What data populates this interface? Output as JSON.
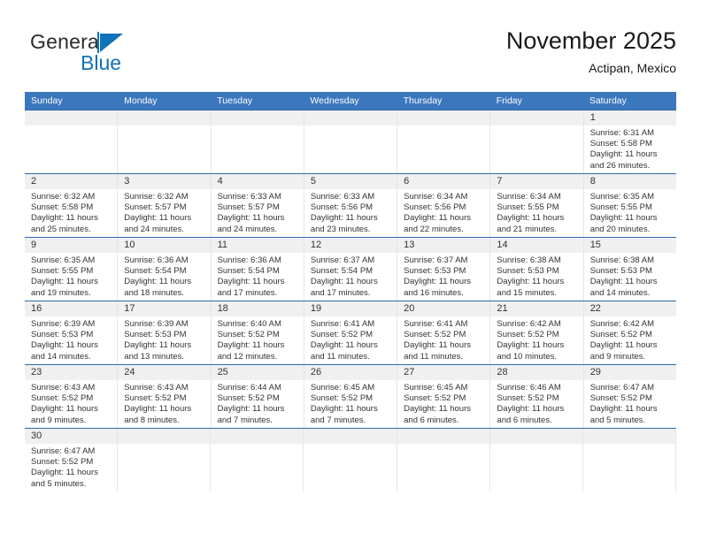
{
  "brand": {
    "name_part1": "General",
    "name_part2": "Blue",
    "accent_color": "#1272b8",
    "triangle_icon": "triangle-icon"
  },
  "header": {
    "title": "November 2025",
    "subtitle": "Actipan, Mexico"
  },
  "calendar": {
    "header_bg": "#3b77bd",
    "weekdays": [
      "Sunday",
      "Monday",
      "Tuesday",
      "Wednesday",
      "Thursday",
      "Friday",
      "Saturday"
    ],
    "weeks": [
      [
        {
          "empty": true
        },
        {
          "empty": true
        },
        {
          "empty": true
        },
        {
          "empty": true
        },
        {
          "empty": true
        },
        {
          "empty": true
        },
        {
          "day": "1",
          "sunrise": "Sunrise: 6:31 AM",
          "sunset": "Sunset: 5:58 PM",
          "daylight1": "Daylight: 11 hours",
          "daylight2": "and 26 minutes."
        }
      ],
      [
        {
          "day": "2",
          "sunrise": "Sunrise: 6:32 AM",
          "sunset": "Sunset: 5:58 PM",
          "daylight1": "Daylight: 11 hours",
          "daylight2": "and 25 minutes."
        },
        {
          "day": "3",
          "sunrise": "Sunrise: 6:32 AM",
          "sunset": "Sunset: 5:57 PM",
          "daylight1": "Daylight: 11 hours",
          "daylight2": "and 24 minutes."
        },
        {
          "day": "4",
          "sunrise": "Sunrise: 6:33 AM",
          "sunset": "Sunset: 5:57 PM",
          "daylight1": "Daylight: 11 hours",
          "daylight2": "and 24 minutes."
        },
        {
          "day": "5",
          "sunrise": "Sunrise: 6:33 AM",
          "sunset": "Sunset: 5:56 PM",
          "daylight1": "Daylight: 11 hours",
          "daylight2": "and 23 minutes."
        },
        {
          "day": "6",
          "sunrise": "Sunrise: 6:34 AM",
          "sunset": "Sunset: 5:56 PM",
          "daylight1": "Daylight: 11 hours",
          "daylight2": "and 22 minutes."
        },
        {
          "day": "7",
          "sunrise": "Sunrise: 6:34 AM",
          "sunset": "Sunset: 5:55 PM",
          "daylight1": "Daylight: 11 hours",
          "daylight2": "and 21 minutes."
        },
        {
          "day": "8",
          "sunrise": "Sunrise: 6:35 AM",
          "sunset": "Sunset: 5:55 PM",
          "daylight1": "Daylight: 11 hours",
          "daylight2": "and 20 minutes."
        }
      ],
      [
        {
          "day": "9",
          "sunrise": "Sunrise: 6:35 AM",
          "sunset": "Sunset: 5:55 PM",
          "daylight1": "Daylight: 11 hours",
          "daylight2": "and 19 minutes."
        },
        {
          "day": "10",
          "sunrise": "Sunrise: 6:36 AM",
          "sunset": "Sunset: 5:54 PM",
          "daylight1": "Daylight: 11 hours",
          "daylight2": "and 18 minutes."
        },
        {
          "day": "11",
          "sunrise": "Sunrise: 6:36 AM",
          "sunset": "Sunset: 5:54 PM",
          "daylight1": "Daylight: 11 hours",
          "daylight2": "and 17 minutes."
        },
        {
          "day": "12",
          "sunrise": "Sunrise: 6:37 AM",
          "sunset": "Sunset: 5:54 PM",
          "daylight1": "Daylight: 11 hours",
          "daylight2": "and 17 minutes."
        },
        {
          "day": "13",
          "sunrise": "Sunrise: 6:37 AM",
          "sunset": "Sunset: 5:53 PM",
          "daylight1": "Daylight: 11 hours",
          "daylight2": "and 16 minutes."
        },
        {
          "day": "14",
          "sunrise": "Sunrise: 6:38 AM",
          "sunset": "Sunset: 5:53 PM",
          "daylight1": "Daylight: 11 hours",
          "daylight2": "and 15 minutes."
        },
        {
          "day": "15",
          "sunrise": "Sunrise: 6:38 AM",
          "sunset": "Sunset: 5:53 PM",
          "daylight1": "Daylight: 11 hours",
          "daylight2": "and 14 minutes."
        }
      ],
      [
        {
          "day": "16",
          "sunrise": "Sunrise: 6:39 AM",
          "sunset": "Sunset: 5:53 PM",
          "daylight1": "Daylight: 11 hours",
          "daylight2": "and 14 minutes."
        },
        {
          "day": "17",
          "sunrise": "Sunrise: 6:39 AM",
          "sunset": "Sunset: 5:53 PM",
          "daylight1": "Daylight: 11 hours",
          "daylight2": "and 13 minutes."
        },
        {
          "day": "18",
          "sunrise": "Sunrise: 6:40 AM",
          "sunset": "Sunset: 5:52 PM",
          "daylight1": "Daylight: 11 hours",
          "daylight2": "and 12 minutes."
        },
        {
          "day": "19",
          "sunrise": "Sunrise: 6:41 AM",
          "sunset": "Sunset: 5:52 PM",
          "daylight1": "Daylight: 11 hours",
          "daylight2": "and 11 minutes."
        },
        {
          "day": "20",
          "sunrise": "Sunrise: 6:41 AM",
          "sunset": "Sunset: 5:52 PM",
          "daylight1": "Daylight: 11 hours",
          "daylight2": "and 11 minutes."
        },
        {
          "day": "21",
          "sunrise": "Sunrise: 6:42 AM",
          "sunset": "Sunset: 5:52 PM",
          "daylight1": "Daylight: 11 hours",
          "daylight2": "and 10 minutes."
        },
        {
          "day": "22",
          "sunrise": "Sunrise: 6:42 AM",
          "sunset": "Sunset: 5:52 PM",
          "daylight1": "Daylight: 11 hours",
          "daylight2": "and 9 minutes."
        }
      ],
      [
        {
          "day": "23",
          "sunrise": "Sunrise: 6:43 AM",
          "sunset": "Sunset: 5:52 PM",
          "daylight1": "Daylight: 11 hours",
          "daylight2": "and 9 minutes."
        },
        {
          "day": "24",
          "sunrise": "Sunrise: 6:43 AM",
          "sunset": "Sunset: 5:52 PM",
          "daylight1": "Daylight: 11 hours",
          "daylight2": "and 8 minutes."
        },
        {
          "day": "25",
          "sunrise": "Sunrise: 6:44 AM",
          "sunset": "Sunset: 5:52 PM",
          "daylight1": "Daylight: 11 hours",
          "daylight2": "and 7 minutes."
        },
        {
          "day": "26",
          "sunrise": "Sunrise: 6:45 AM",
          "sunset": "Sunset: 5:52 PM",
          "daylight1": "Daylight: 11 hours",
          "daylight2": "and 7 minutes."
        },
        {
          "day": "27",
          "sunrise": "Sunrise: 6:45 AM",
          "sunset": "Sunset: 5:52 PM",
          "daylight1": "Daylight: 11 hours",
          "daylight2": "and 6 minutes."
        },
        {
          "day": "28",
          "sunrise": "Sunrise: 6:46 AM",
          "sunset": "Sunset: 5:52 PM",
          "daylight1": "Daylight: 11 hours",
          "daylight2": "and 6 minutes."
        },
        {
          "day": "29",
          "sunrise": "Sunrise: 6:47 AM",
          "sunset": "Sunset: 5:52 PM",
          "daylight1": "Daylight: 11 hours",
          "daylight2": "and 5 minutes."
        }
      ],
      [
        {
          "day": "30",
          "sunrise": "Sunrise: 6:47 AM",
          "sunset": "Sunset: 5:52 PM",
          "daylight1": "Daylight: 11 hours",
          "daylight2": "and 5 minutes."
        },
        {
          "empty": true
        },
        {
          "empty": true
        },
        {
          "empty": true
        },
        {
          "empty": true
        },
        {
          "empty": true
        },
        {
          "empty": true
        }
      ]
    ]
  }
}
